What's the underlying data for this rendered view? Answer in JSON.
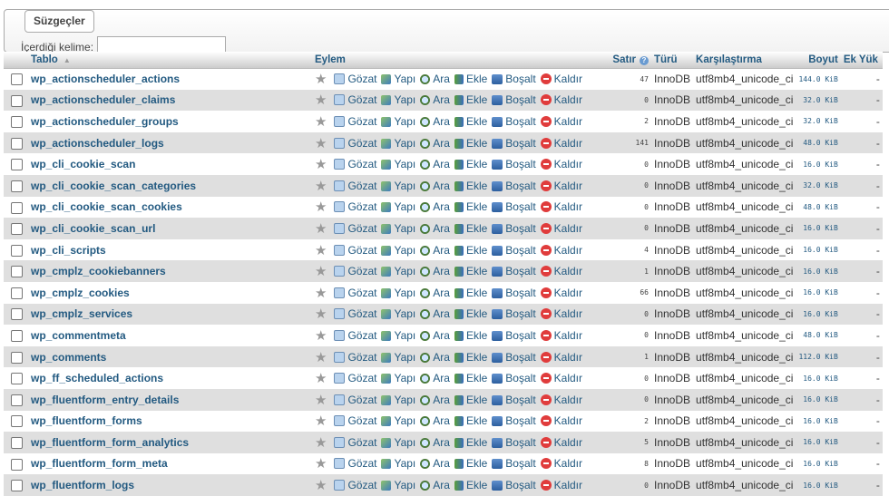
{
  "filters": {
    "legend": "Süzgeçler",
    "label": "İçerdiği kelime:",
    "input_value": ""
  },
  "columns": {
    "table": "Tablo",
    "action": "Eylem",
    "rows": "Satır",
    "type": "Türü",
    "collation": "Karşılaştırma",
    "size": "Boyut",
    "overhead": "Ek Yük"
  },
  "actions": {
    "browse": "Gözat",
    "structure": "Yapı",
    "search": "Ara",
    "insert": "Ekle",
    "empty": "Boşalt",
    "drop": "Kaldır"
  },
  "rows": [
    {
      "name": "wp_actionscheduler_actions",
      "rows": "47",
      "type": "InnoDB",
      "collation": "utf8mb4_unicode_ci",
      "size": "144.0 KiB",
      "overhead": "-"
    },
    {
      "name": "wp_actionscheduler_claims",
      "rows": "0",
      "type": "InnoDB",
      "collation": "utf8mb4_unicode_ci",
      "size": "32.0 KiB",
      "overhead": "-"
    },
    {
      "name": "wp_actionscheduler_groups",
      "rows": "2",
      "type": "InnoDB",
      "collation": "utf8mb4_unicode_ci",
      "size": "32.0 KiB",
      "overhead": "-"
    },
    {
      "name": "wp_actionscheduler_logs",
      "rows": "141",
      "type": "InnoDB",
      "collation": "utf8mb4_unicode_ci",
      "size": "48.0 KiB",
      "overhead": "-"
    },
    {
      "name": "wp_cli_cookie_scan",
      "rows": "0",
      "type": "InnoDB",
      "collation": "utf8mb4_unicode_ci",
      "size": "16.0 KiB",
      "overhead": "-"
    },
    {
      "name": "wp_cli_cookie_scan_categories",
      "rows": "0",
      "type": "InnoDB",
      "collation": "utf8mb4_unicode_ci",
      "size": "32.0 KiB",
      "overhead": "-"
    },
    {
      "name": "wp_cli_cookie_scan_cookies",
      "rows": "0",
      "type": "InnoDB",
      "collation": "utf8mb4_unicode_ci",
      "size": "48.0 KiB",
      "overhead": "-"
    },
    {
      "name": "wp_cli_cookie_scan_url",
      "rows": "0",
      "type": "InnoDB",
      "collation": "utf8mb4_unicode_ci",
      "size": "16.0 KiB",
      "overhead": "-"
    },
    {
      "name": "wp_cli_scripts",
      "rows": "4",
      "type": "InnoDB",
      "collation": "utf8mb4_unicode_ci",
      "size": "16.0 KiB",
      "overhead": "-"
    },
    {
      "name": "wp_cmplz_cookiebanners",
      "rows": "1",
      "type": "InnoDB",
      "collation": "utf8mb4_unicode_ci",
      "size": "16.0 KiB",
      "overhead": "-"
    },
    {
      "name": "wp_cmplz_cookies",
      "rows": "66",
      "type": "InnoDB",
      "collation": "utf8mb4_unicode_ci",
      "size": "16.0 KiB",
      "overhead": "-"
    },
    {
      "name": "wp_cmplz_services",
      "rows": "0",
      "type": "InnoDB",
      "collation": "utf8mb4_unicode_ci",
      "size": "16.0 KiB",
      "overhead": "-"
    },
    {
      "name": "wp_commentmeta",
      "rows": "0",
      "type": "InnoDB",
      "collation": "utf8mb4_unicode_ci",
      "size": "48.0 KiB",
      "overhead": "-"
    },
    {
      "name": "wp_comments",
      "rows": "1",
      "type": "InnoDB",
      "collation": "utf8mb4_unicode_ci",
      "size": "112.0 KiB",
      "overhead": "-"
    },
    {
      "name": "wp_ff_scheduled_actions",
      "rows": "0",
      "type": "InnoDB",
      "collation": "utf8mb4_unicode_ci",
      "size": "16.0 KiB",
      "overhead": "-"
    },
    {
      "name": "wp_fluentform_entry_details",
      "rows": "0",
      "type": "InnoDB",
      "collation": "utf8mb4_unicode_ci",
      "size": "16.0 KiB",
      "overhead": "-"
    },
    {
      "name": "wp_fluentform_forms",
      "rows": "2",
      "type": "InnoDB",
      "collation": "utf8mb4_unicode_ci",
      "size": "16.0 KiB",
      "overhead": "-"
    },
    {
      "name": "wp_fluentform_form_analytics",
      "rows": "5",
      "type": "InnoDB",
      "collation": "utf8mb4_unicode_ci",
      "size": "16.0 KiB",
      "overhead": "-"
    },
    {
      "name": "wp_fluentform_form_meta",
      "rows": "8",
      "type": "InnoDB",
      "collation": "utf8mb4_unicode_ci",
      "size": "16.0 KiB",
      "overhead": "-"
    },
    {
      "name": "wp_fluentform_logs",
      "rows": "0",
      "type": "InnoDB",
      "collation": "utf8mb4_unicode_ci",
      "size": "16.0 KiB",
      "overhead": "-"
    }
  ]
}
